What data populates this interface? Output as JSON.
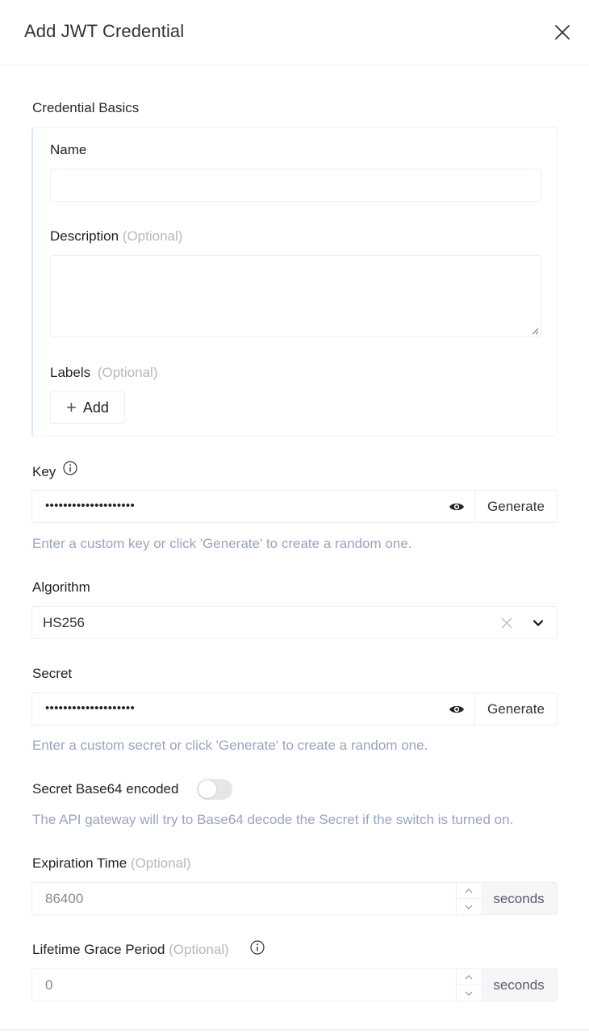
{
  "header": {
    "title": "Add JWT Credential",
    "close_icon": "close-icon"
  },
  "basics": {
    "section_title": "Credential Basics",
    "name": {
      "label": "Name",
      "value": "",
      "placeholder": ""
    },
    "description": {
      "label": "Description",
      "optional": "(Optional)",
      "value": "",
      "placeholder": ""
    },
    "labels": {
      "label": "Labels",
      "optional": "(Optional)",
      "add_button": "Add",
      "add_icon": "plus-icon"
    }
  },
  "key": {
    "label": "Key",
    "info_icon": "info-icon",
    "masked_value": "••••••••••••••••••••",
    "reveal_icon": "eye-icon",
    "generate_button": "Generate",
    "hint": "Enter a custom key or click 'Generate' to create a random one."
  },
  "algorithm": {
    "label": "Algorithm",
    "selected": "HS256",
    "clear_icon": "close-icon",
    "dropdown_icon": "chevron-down-icon"
  },
  "secret": {
    "label": "Secret",
    "masked_value": "••••••••••••••••••••",
    "reveal_icon": "eye-icon",
    "generate_button": "Generate",
    "hint": "Enter a custom secret or click 'Generate' to create a random one."
  },
  "base64": {
    "label": "Secret Base64 encoded",
    "enabled": false,
    "hint": "The API gateway will try to Base64 decode the Secret if the switch is turned on."
  },
  "expiration": {
    "label": "Expiration Time",
    "optional": "(Optional)",
    "placeholder": "86400",
    "unit": "seconds"
  },
  "grace_period": {
    "label": "Lifetime Grace Period",
    "optional": "(Optional)",
    "info_icon": "info-icon",
    "placeholder": "0",
    "unit": "seconds"
  },
  "colors": {
    "hint_text": "#9aa4c0",
    "optional_text": "#b8b8bc",
    "box_accent": "#dbe8f7"
  }
}
